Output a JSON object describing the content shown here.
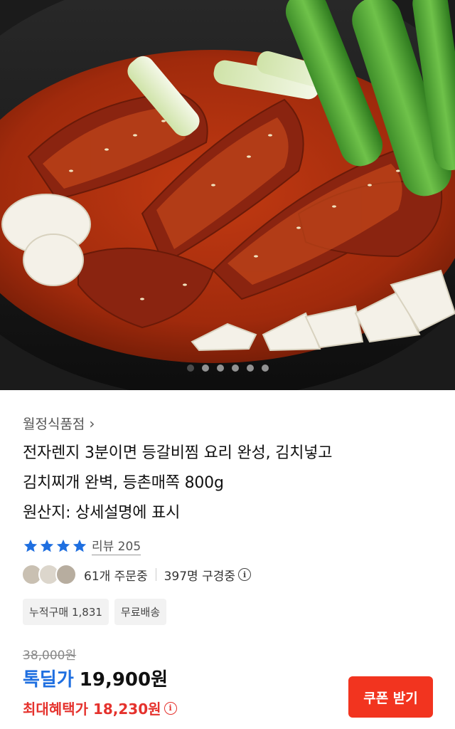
{
  "carousel": {
    "image_description": "",
    "slide_count": 6,
    "active_index": 0
  },
  "product": {
    "seller": "월정식품점",
    "title_lines": [
      "전자렌지 3분이면 등갈비찜 요리 완성, 김치넣고",
      "김치찌개 완벽, 등촌매쪽 800g",
      "원산지: 상세설명에 표시"
    ],
    "rating_stars": 4,
    "review_label": "리뷰 205",
    "ordering": "61개 주문중",
    "watching": "397명 구경중",
    "chips": [
      "누적구매 1,831",
      "무료배송"
    ],
    "original_price": "38,000원",
    "deal_label": "톡딜가",
    "deal_price": "19,900원",
    "max_benefit": "최대혜택가 18,230원",
    "coupon_button": "쿠폰 받기"
  },
  "colors": {
    "accent_blue": "#1f6fe0",
    "accent_red": "#e5322d",
    "coupon_bg": "#f2341f"
  }
}
